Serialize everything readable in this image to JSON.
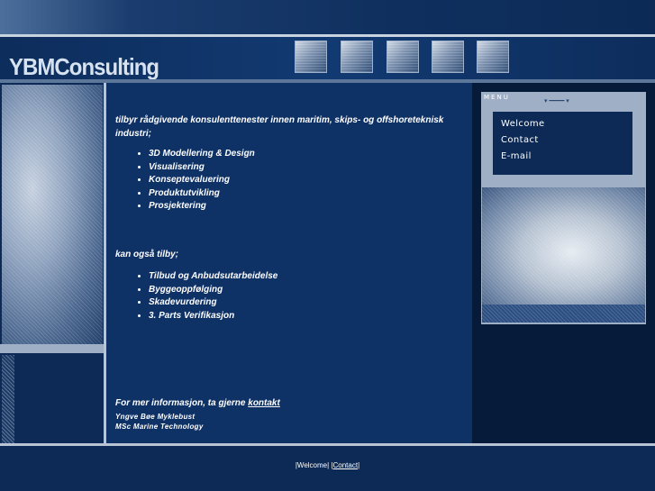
{
  "header": {
    "logo": "YBMConsulting",
    "thumbnails": [
      "thumbnail-cad-icon",
      "thumbnail-hands-icon",
      "thumbnail-eye-icon",
      "thumbnail-ship-icon",
      "thumbnail-machinery-icon"
    ]
  },
  "main": {
    "intro": "tilbyr rådgivende konsulenttenester innen maritim, skips- og offshoreteknisk industri;",
    "services": [
      "3D Modellering & Design",
      "Visualisering",
      "Konseptevaluering",
      "Produktutvikling",
      "Prosjektering"
    ],
    "intro2": "kan også tilby;",
    "extra_services": [
      "Tilbud og Anbudsutarbeidelse",
      "Byggeoppfølging",
      "Skadevurdering",
      "3. Parts Verifikasjon"
    ],
    "info_text": "For mer informasjon, ta gjerne ",
    "info_link": "kontakt",
    "signature_name": "Yngve Bøe Myklebust",
    "signature_title": "MSc Marine Technology"
  },
  "menu": {
    "title": "MENU",
    "items": [
      "Welcome",
      "Contact",
      "E-mail"
    ]
  },
  "footer": {
    "link1": "Welcome",
    "link2": "Contact"
  }
}
